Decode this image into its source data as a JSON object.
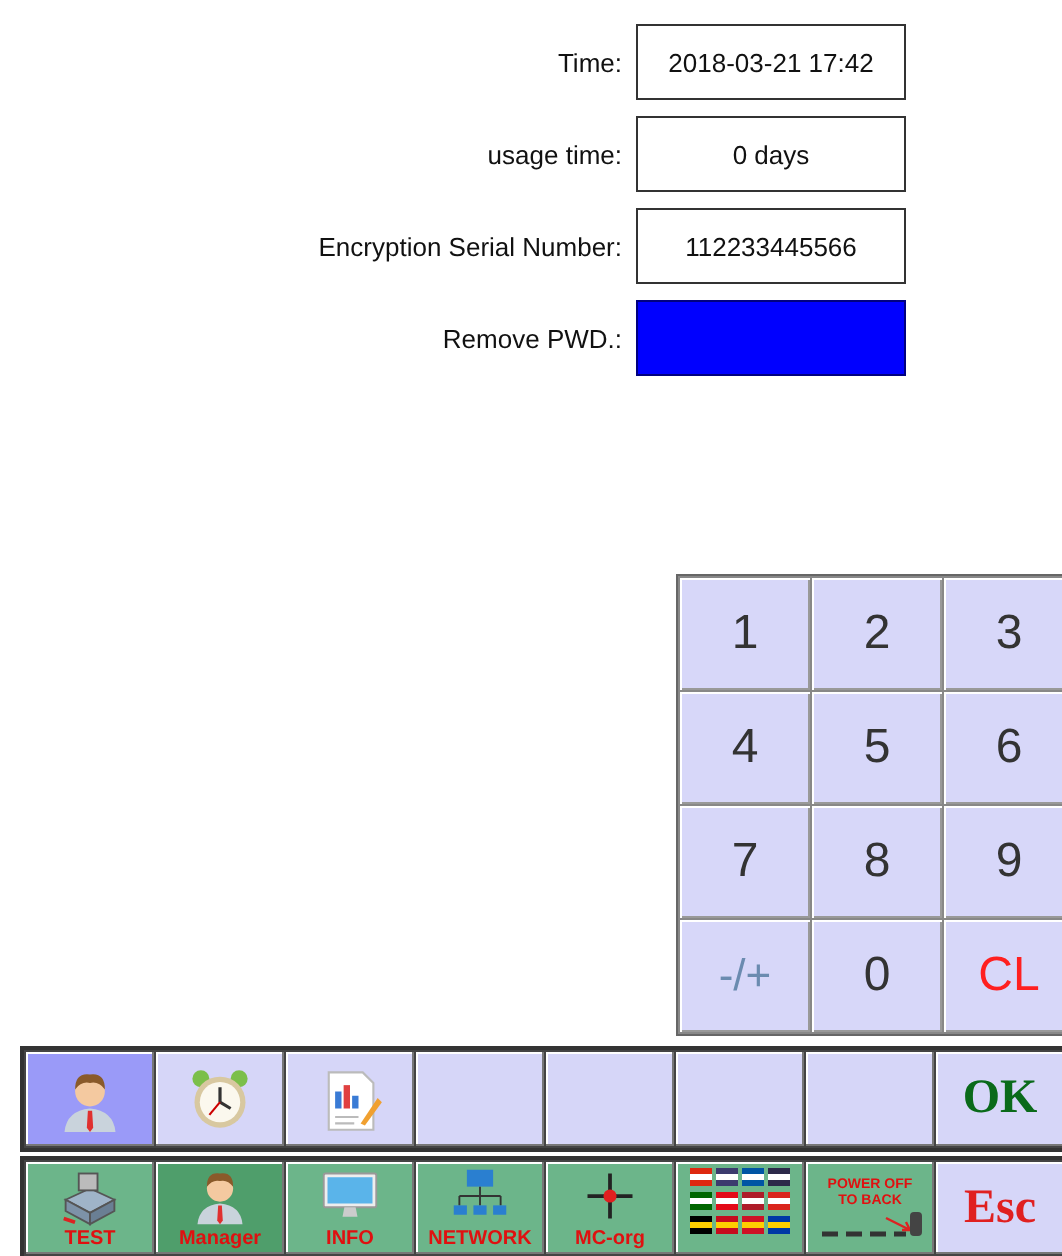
{
  "fields": [
    {
      "label": "Time:",
      "value": "2018-03-21 17:42",
      "selected": false
    },
    {
      "label": "usage time:",
      "value": "0 days",
      "selected": false
    },
    {
      "label": "Encryption Serial Number:",
      "value": "112233445566",
      "selected": false
    },
    {
      "label": "Remove PWD.:",
      "selected": true
    }
  ],
  "keypad": [
    {
      "label": "1",
      "kind": "digit"
    },
    {
      "label": "2",
      "kind": "digit"
    },
    {
      "label": "3",
      "kind": "digit"
    },
    {
      "label": "4",
      "kind": "digit"
    },
    {
      "label": "5",
      "kind": "digit"
    },
    {
      "label": "6",
      "kind": "digit"
    },
    {
      "label": "7",
      "kind": "digit"
    },
    {
      "label": "8",
      "kind": "digit"
    },
    {
      "label": "9",
      "kind": "digit"
    },
    {
      "label": "-/+",
      "kind": "sign"
    },
    {
      "label": "0",
      "kind": "digit"
    },
    {
      "label": "CL",
      "kind": "clear"
    }
  ],
  "toolbar": [
    {
      "kind": "icon",
      "selected": true
    },
    {
      "kind": "icon",
      "selected": false
    },
    {
      "kind": "icon",
      "selected": false
    },
    {
      "kind": "blank",
      "selected": false
    },
    {
      "kind": "blank",
      "selected": false
    },
    {
      "kind": "blank",
      "selected": false
    },
    {
      "kind": "blank",
      "selected": false
    },
    {
      "kind": "text",
      "label": "OK",
      "selected": false
    }
  ],
  "tabs": [
    {
      "kind": "icon",
      "label": "TEST",
      "selected": false
    },
    {
      "kind": "icon",
      "label": "Manager",
      "selected": true
    },
    {
      "kind": "icon",
      "label": "INFO",
      "selected": false
    },
    {
      "kind": "icon",
      "label": "NETWORK",
      "selected": false
    },
    {
      "kind": "icon",
      "label": "MC-org",
      "selected": false
    },
    {
      "kind": "icon",
      "selected": false
    },
    {
      "kind": "poster",
      "lines": [
        "POWER OFF",
        "TO BACK"
      ],
      "selected": false
    },
    {
      "kind": "text",
      "label": "Esc",
      "selected": false
    }
  ]
}
